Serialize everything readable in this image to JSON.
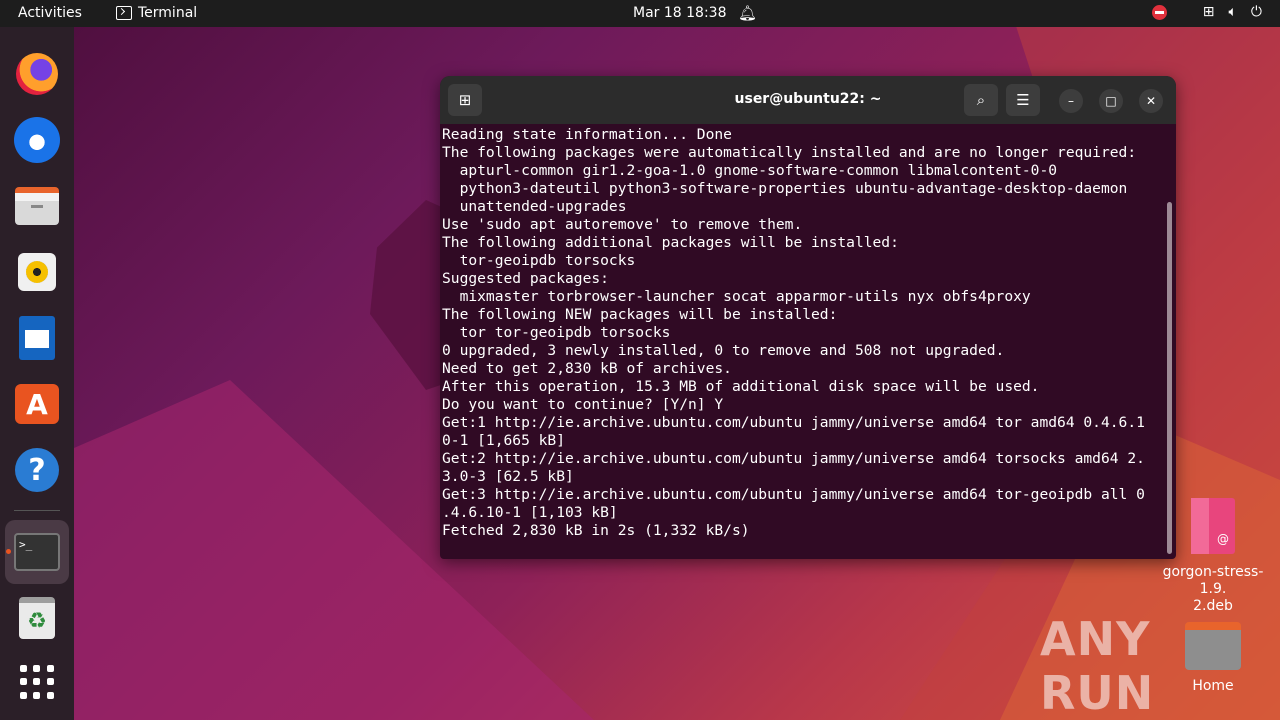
{
  "topbar": {
    "activities": "Activities",
    "app_name": "Terminal",
    "clock": "Mar 18  18:38"
  },
  "dock": {
    "items": [
      "firefox",
      "thunderbird",
      "files",
      "rhythmbox",
      "libreoffice-writer",
      "app-center",
      "help",
      "terminal",
      "trash",
      "show-apps"
    ],
    "terminal_glyph": ">_"
  },
  "window": {
    "title": "user@ubuntu22: ~",
    "lines": [
      "Reading state information... Done",
      "The following packages were automatically installed and are no longer required:",
      "  apturl-common gir1.2-goa-1.0 gnome-software-common libmalcontent-0-0",
      "  python3-dateutil python3-software-properties ubuntu-advantage-desktop-daemon",
      "  unattended-upgrades",
      "Use 'sudo apt autoremove' to remove them.",
      "The following additional packages will be installed:",
      "  tor-geoipdb torsocks",
      "Suggested packages:",
      "  mixmaster torbrowser-launcher socat apparmor-utils nyx obfs4proxy",
      "The following NEW packages will be installed:",
      "  tor tor-geoipdb torsocks",
      "0 upgraded, 3 newly installed, 0 to remove and 508 not upgraded.",
      "Need to get 2,830 kB of archives.",
      "After this operation, 15.3 MB of additional disk space will be used.",
      "Do you want to continue? [Y/n] Y",
      "Get:1 http://ie.archive.ubuntu.com/ubuntu jammy/universe amd64 tor amd64 0.4.6.1",
      "0-1 [1,665 kB]",
      "Get:2 http://ie.archive.ubuntu.com/ubuntu jammy/universe amd64 torsocks amd64 2.",
      "3.0-3 [62.5 kB]",
      "Get:3 http://ie.archive.ubuntu.com/ubuntu jammy/universe amd64 tor-geoipdb all 0",
      ".4.6.10-1 [1,103 kB]",
      "Fetched 2,830 kB in 2s (1,332 kB/s)"
    ]
  },
  "desktop": {
    "deb_file_line1": "gorgon-stress-1.9.",
    "deb_file_line2": "2.deb",
    "home_label": "Home"
  },
  "watermark": "ANY RUN",
  "colors": {
    "terminal_bg": "#300a24",
    "topbar_bg": "#1d1d1d",
    "accent": "#e95420"
  }
}
